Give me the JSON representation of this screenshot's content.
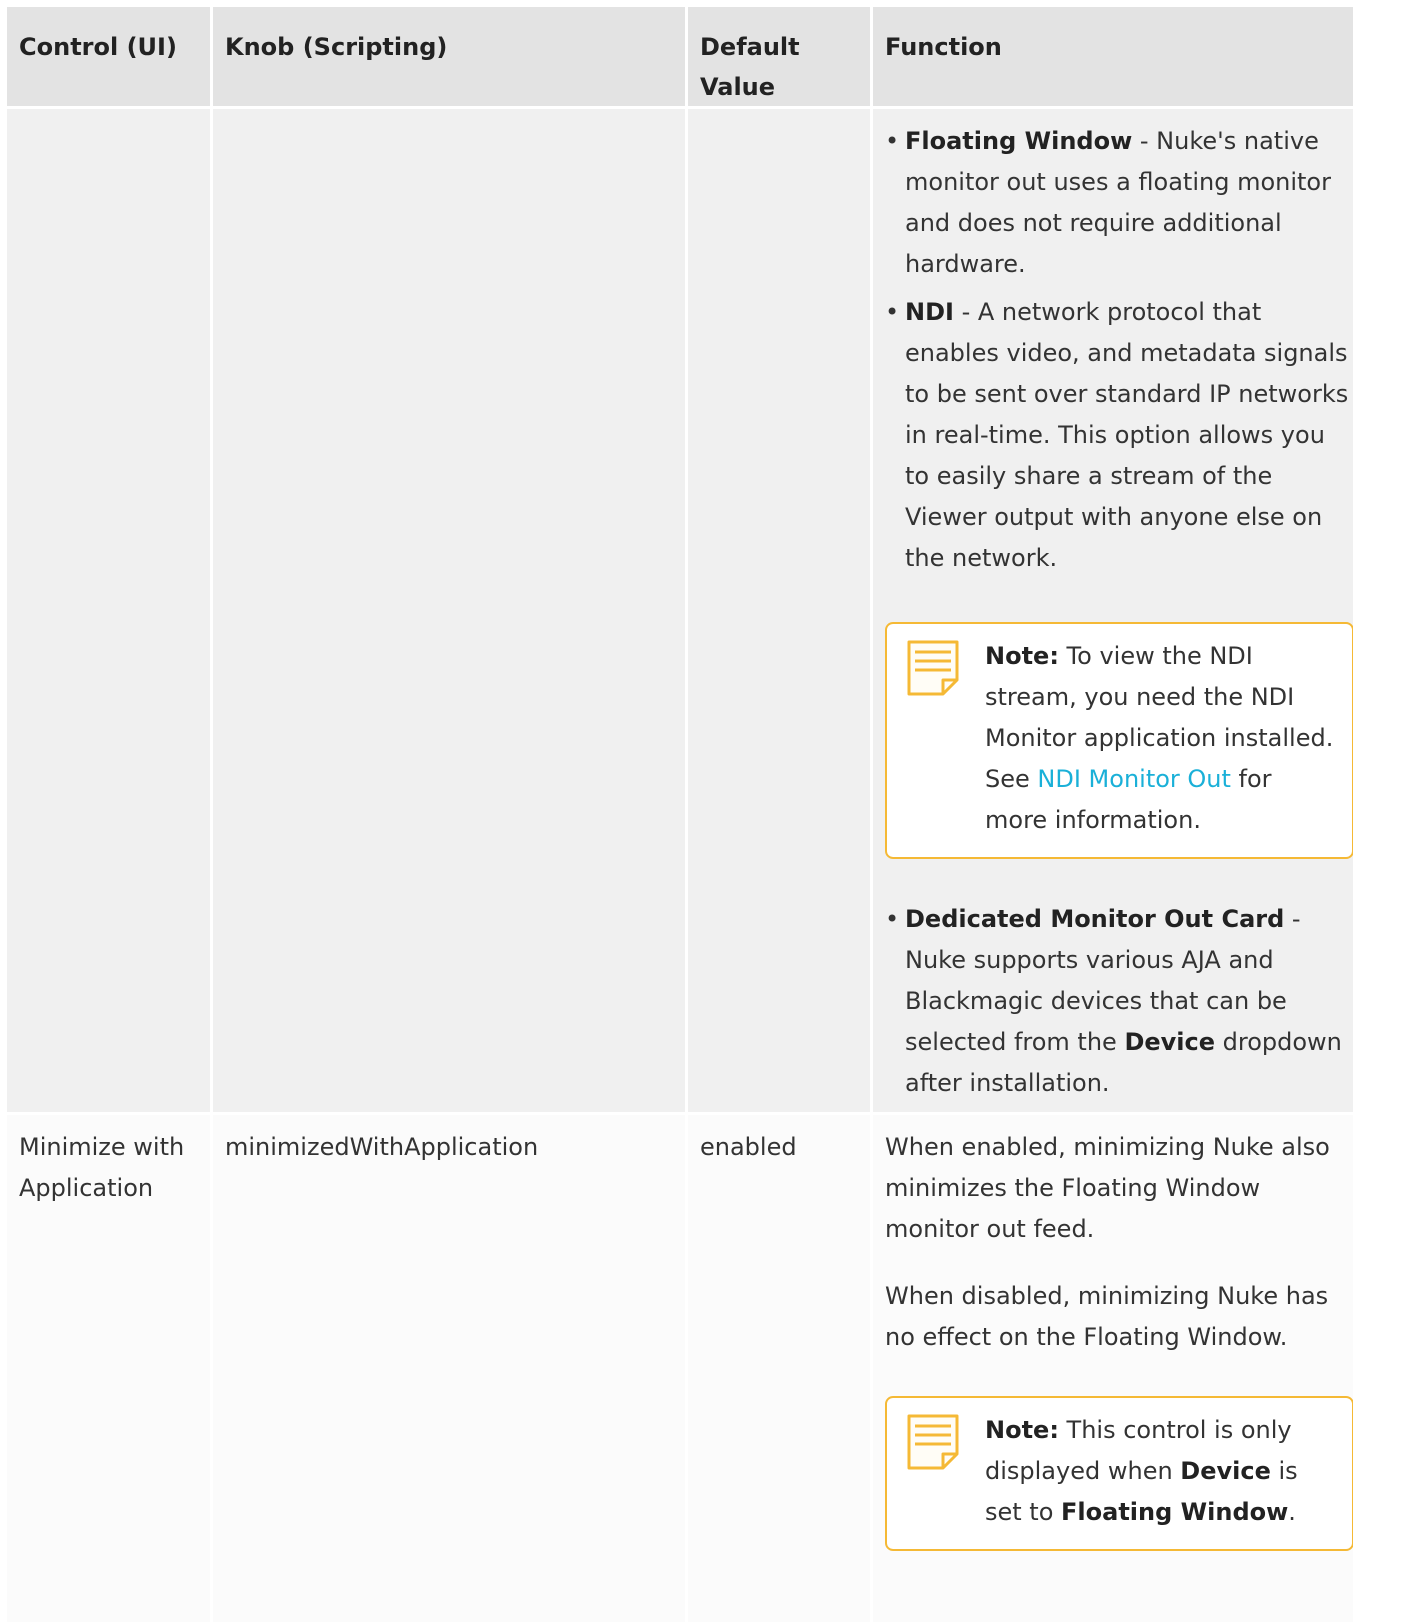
{
  "headers": {
    "col1": "Control (UI)",
    "col2": "Knob (Scripting)",
    "col3": "Default Value",
    "col4": "Function"
  },
  "row1": {
    "bullet1": {
      "bold": "Floating Window",
      "text": " - Nuke's native monitor out uses a floating monitor and does not require additional hardware."
    },
    "bullet2": {
      "bold": "NDI",
      "text": " - A network protocol that enables video, and metadata signals to be sent over standard IP networks in real-time. This option allows you to easily share a stream of the Viewer output with anyone else on the network."
    },
    "note": {
      "label": "Note:",
      "text1": " To view the NDI stream, you need the NDI Monitor application installed. See ",
      "link": "NDI Monitor Out",
      "text2": " for more information."
    },
    "bullet3": {
      "bold": "Dedicated Monitor Out Card",
      "text1": " - Nuke supports various AJA and Blackmagic devices that can be selected from the ",
      "bold2": "Device",
      "text2": " dropdown after installation."
    }
  },
  "row2": {
    "control": "Minimize with Application",
    "knob": "minimizedWithApplication",
    "default": "enabled",
    "para1": "When enabled, minimizing Nuke also minimizes the Floating Window monitor out feed.",
    "para2": "When disabled, minimizing Nuke has no effect on the Floating Window.",
    "note": {
      "label": "Note:",
      "text1": " This control is only displayed when ",
      "bold1": "Device",
      "text2": " is set to ",
      "bold2": "Floating Window",
      "text3": "."
    }
  },
  "colors": {
    "header_bg": "#e3e3e3",
    "row_gray": "#f0f0f0",
    "row_white": "#fbfbfb",
    "note_border": "#f5b935",
    "link": "#1ab0d8"
  },
  "icons": {
    "note": "note-icon"
  }
}
